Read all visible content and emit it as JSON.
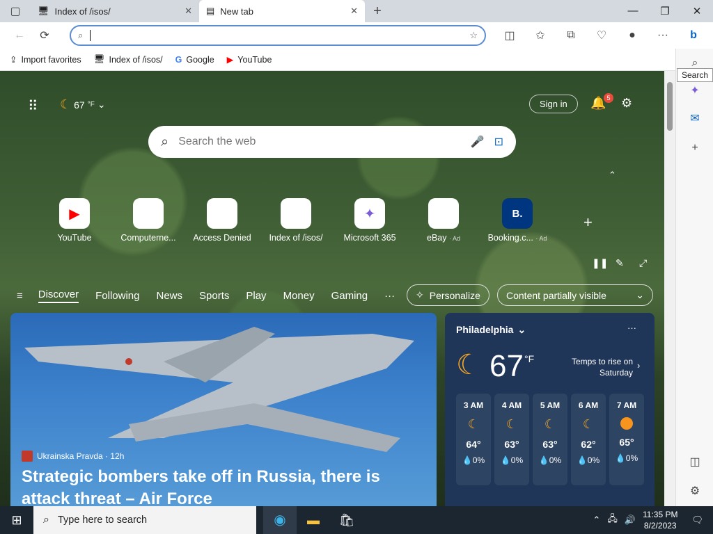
{
  "tabs": [
    {
      "label": "Index of /isos/",
      "active": false
    },
    {
      "label": "New tab",
      "active": true
    }
  ],
  "window_controls": [
    "minimize",
    "restore",
    "close"
  ],
  "address": {
    "value": "",
    "placeholder": ""
  },
  "favorites": [
    {
      "label": "Import favorites",
      "icon": "import-icon"
    },
    {
      "label": "Index of /isos/",
      "icon": "server-icon"
    },
    {
      "label": "Google",
      "icon": "google-icon"
    },
    {
      "label": "YouTube",
      "icon": "youtube-icon"
    }
  ],
  "tooltip": "Search",
  "newtab": {
    "weather_temp": "67",
    "weather_unit": "°F",
    "sign_in": "Sign in",
    "notification_count": "5",
    "search_placeholder": "Search the web",
    "quicklinks": [
      {
        "label": "YouTube",
        "ad": ""
      },
      {
        "label": "Computerne...",
        "ad": ""
      },
      {
        "label": "Access Denied",
        "ad": ""
      },
      {
        "label": "Index of /isos/",
        "ad": ""
      },
      {
        "label": "Microsoft 365",
        "ad": ""
      },
      {
        "label": "eBay",
        "ad": "· Ad"
      },
      {
        "label": "Booking.c...",
        "ad": "· Ad"
      }
    ],
    "nav_tabs": [
      "Discover",
      "Following",
      "News",
      "Sports",
      "Play",
      "Money",
      "Gaming"
    ],
    "more": "···",
    "personalize": "Personalize",
    "content_visibility": "Content partially visible",
    "news": {
      "source": "Ukrainska Pravda · 12h",
      "headline": "Strategic bombers take off in Russia, there is attack threat – Air Force"
    },
    "weather": {
      "city": "Philadelphia",
      "temp": "67",
      "unit": "°F",
      "note_line1": "Temps to rise on",
      "note_line2": "Saturday",
      "hours": [
        {
          "time": "3 AM",
          "temp": "64°",
          "precip": "0%",
          "icon": "moon-icon"
        },
        {
          "time": "4 AM",
          "temp": "63°",
          "precip": "0%",
          "icon": "moon-icon"
        },
        {
          "time": "5 AM",
          "temp": "63°",
          "precip": "0%",
          "icon": "moon-icon"
        },
        {
          "time": "6 AM",
          "temp": "62°",
          "precip": "0%",
          "icon": "moon-icon"
        },
        {
          "time": "7 AM",
          "temp": "65°",
          "precip": "0%",
          "icon": "sun-icon"
        }
      ]
    }
  },
  "taskbar": {
    "search_placeholder": "Type here to search",
    "time": "11:35 PM",
    "date": "8/2/2023"
  },
  "colors": {
    "accent": "#0a66c2",
    "taskbar": "#1c2630",
    "weather_card": "#1f3658"
  }
}
